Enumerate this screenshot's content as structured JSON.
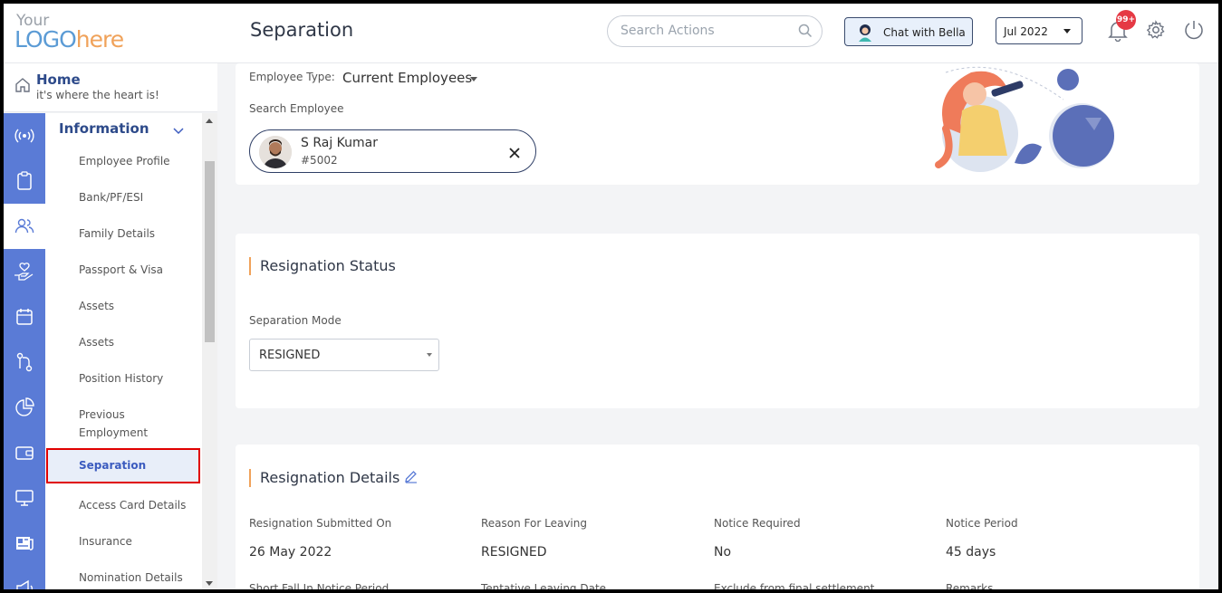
{
  "header": {
    "logo_line1": "Your",
    "logo_line2a": "LOGO",
    "logo_line2b": "here",
    "page_title": "Separation",
    "search_placeholder": "Search Actions",
    "chat_label": "Chat with Bella",
    "month_value": "Jul 2022",
    "notification_count": "99+"
  },
  "home": {
    "title": "Home",
    "subtitle": "it's where the heart is!"
  },
  "rail": {
    "icons": [
      "broadcast-icon",
      "clipboard-icon",
      "people-icon",
      "hand-heart-icon",
      "calendar-icon",
      "flow-icon",
      "pie-chart-icon",
      "wallet-icon",
      "monitor-icon",
      "newspaper-icon",
      "megaphone-icon"
    ]
  },
  "sidebar": {
    "section": "Information",
    "items": [
      "Employee Profile",
      "Bank/PF/ESI",
      "Family Details",
      "Passport & Visa",
      "Assets",
      "Assets",
      "Position History",
      "Previous Employment",
      "Separation",
      "Access Card Details",
      "Insurance",
      "Nomination Details"
    ],
    "active": "Separation"
  },
  "employee": {
    "type_label": "Employee Type:",
    "type_value": "Current Employees",
    "search_label": "Search Employee",
    "name": "S Raj Kumar",
    "id": "#5002"
  },
  "resignation_status": {
    "title": "Resignation Status",
    "mode_label": "Separation Mode",
    "mode_value": "RESIGNED"
  },
  "resignation_details": {
    "title": "Resignation Details",
    "columns": [
      {
        "label": "Resignation Submitted On",
        "value": "26 May 2022",
        "next_label": "Short Fall In Notice Period"
      },
      {
        "label": "Reason For Leaving",
        "value": "RESIGNED",
        "next_label": "Tentative Leaving Date"
      },
      {
        "label": "Notice Required",
        "value": "No",
        "next_label": "Exclude from final settlement"
      },
      {
        "label": "Notice Period",
        "value": "45 days",
        "next_label": "Remarks"
      }
    ]
  },
  "colors": {
    "accent": "#5a7bd6",
    "title_blue": "#2d4a8a",
    "highlight_border": "#e00000",
    "badge": "#e53944",
    "section_bar": "#f0a25a"
  }
}
